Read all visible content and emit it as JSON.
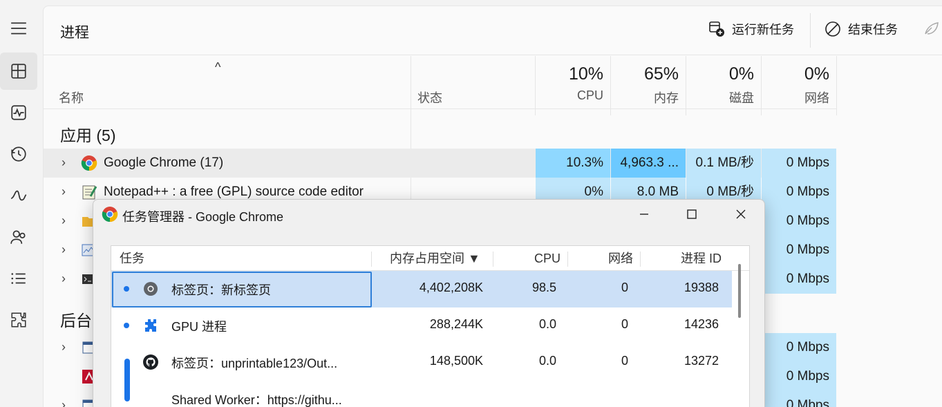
{
  "rail": {
    "items": [
      {
        "name": "menu-icon"
      },
      {
        "name": "processes-icon",
        "active": true
      },
      {
        "name": "performance-icon"
      },
      {
        "name": "app-history-icon"
      },
      {
        "name": "startup-apps-icon"
      },
      {
        "name": "users-icon"
      },
      {
        "name": "details-icon"
      },
      {
        "name": "services-icon"
      }
    ]
  },
  "header": {
    "title": "进程",
    "run_task": "运行新任务",
    "end_task": "结束任务"
  },
  "columns": {
    "sort_indicator": "^",
    "name": "名称",
    "status": "状态",
    "cpu": {
      "pct": "10%",
      "label": "CPU"
    },
    "memory": {
      "pct": "65%",
      "label": "内存"
    },
    "disk": {
      "pct": "0%",
      "label": "磁盘"
    },
    "network": {
      "pct": "0%",
      "label": "网络"
    }
  },
  "groups": {
    "apps": "应用 (5)",
    "background": "后台"
  },
  "rows": [
    {
      "name": "Google Chrome (17)",
      "cpu": "10.3%",
      "memory": "4,963.3 ...",
      "disk": "0.1 MB/秒",
      "network": "0 Mbps"
    },
    {
      "name": "Notepad++ : a free (GPL) source code editor",
      "cpu": "0%",
      "memory": "8.0 MB",
      "disk": "0 MB/秒",
      "network": "0 Mbps"
    },
    {
      "network": "0 Mbps"
    },
    {
      "network": "0 Mbps"
    },
    {
      "network": "0 Mbps"
    },
    {
      "network": "0 Mbps"
    },
    {
      "network": "0 Mbps"
    },
    {
      "network": "0 Mbps"
    }
  ],
  "popup": {
    "title": "任务管理器 - Google Chrome",
    "headers": {
      "task": "任务",
      "memory": "内存占用空间 ▼",
      "cpu": "CPU",
      "network": "网络",
      "pid": "进程 ID"
    },
    "tasks": [
      {
        "task": "标签页：新标签页",
        "memory": "4,402,208K",
        "cpu": "98.5",
        "network": "0",
        "pid": "19388"
      },
      {
        "task": "GPU 进程",
        "memory": "288,244K",
        "cpu": "0.0",
        "network": "0",
        "pid": "14236"
      },
      {
        "task": "标签页：unprintable123/Out...",
        "memory": "148,500K",
        "cpu": "0.0",
        "network": "0",
        "pid": "13272"
      },
      {
        "task": "Shared Worker：https://githu..."
      }
    ]
  }
}
